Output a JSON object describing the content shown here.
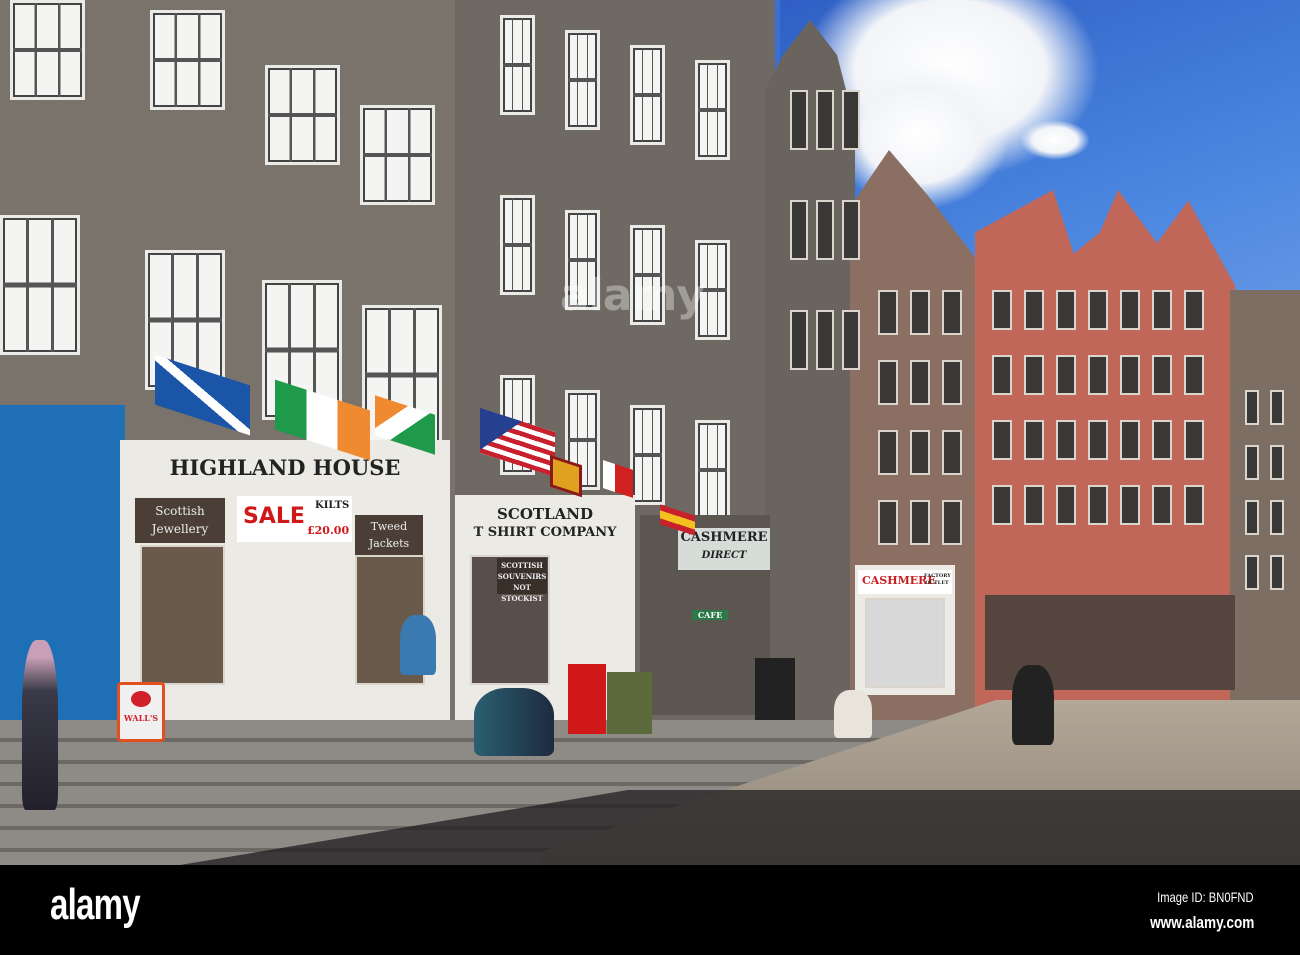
{
  "signs": {
    "highland_house": "HIGHLAND HOUSE",
    "scottish_jewellery": "Scottish Jewellery",
    "sale": "SALE",
    "kilts": "KILTS",
    "kilts_price": "£20.00",
    "tweed_jackets": "Tweed Jackets",
    "scotland_line1": "SCOTLAND",
    "scotland_line2": "T SHIRT COMPANY",
    "souvenirs": "SCOTTISH SOUVENIRS",
    "stockist": "NOT STOCKIST",
    "cashmere_direct_1": "CASHMERE",
    "cashmere_direct_2": "DIRECT",
    "cashmere_outlet": "CASHMERE",
    "factory_outlet": "FACTORY OUTLET",
    "walls": "WALL'S",
    "cafe": "CAFE"
  },
  "watermark": "alamy",
  "footer": {
    "logo": "alamy",
    "image_id": "Image ID: BN0FND",
    "website": "www.alamy.com"
  },
  "colors": {
    "sky": "#3d6fd1",
    "stone": "#7c756d",
    "red_sandstone": "#c0675a",
    "shop_blue": "#1e6fb5"
  }
}
